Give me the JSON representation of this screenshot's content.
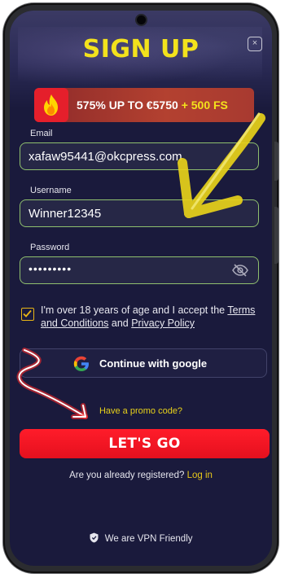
{
  "header": {
    "title": "SIGN UP",
    "close_icon": "×"
  },
  "promo_banner": {
    "main": "575% UP TO €5750",
    "extra": "+ 500 FS"
  },
  "form": {
    "email_label": "Email",
    "email_value": "xafaw95441@okcpress.com",
    "username_label": "Username",
    "username_value": "Winner12345",
    "password_label": "Password",
    "password_value": "•••••••••"
  },
  "terms": {
    "prefix": "I'm over 18 years of age and I accept the ",
    "terms_link": "Terms and Conditions",
    "and": " and ",
    "privacy_link": "Privacy Policy"
  },
  "google_button": "Continue with google",
  "promo_code_link": "Have a promo code?",
  "submit_button": "LET'S GO",
  "registered": {
    "text": "Are you already registered? ",
    "link": "Log in"
  },
  "vpn_text": "We are VPN Friendly",
  "colors": {
    "background": "#1a1a3c",
    "accent_yellow": "#f3e21c",
    "submit_red": "#ff1c2a",
    "field_border": "#8fbf6e"
  },
  "icons": [
    "close-icon",
    "fire-icon",
    "eye-slash-icon",
    "google-icon",
    "shield-icon",
    "check-icon"
  ]
}
